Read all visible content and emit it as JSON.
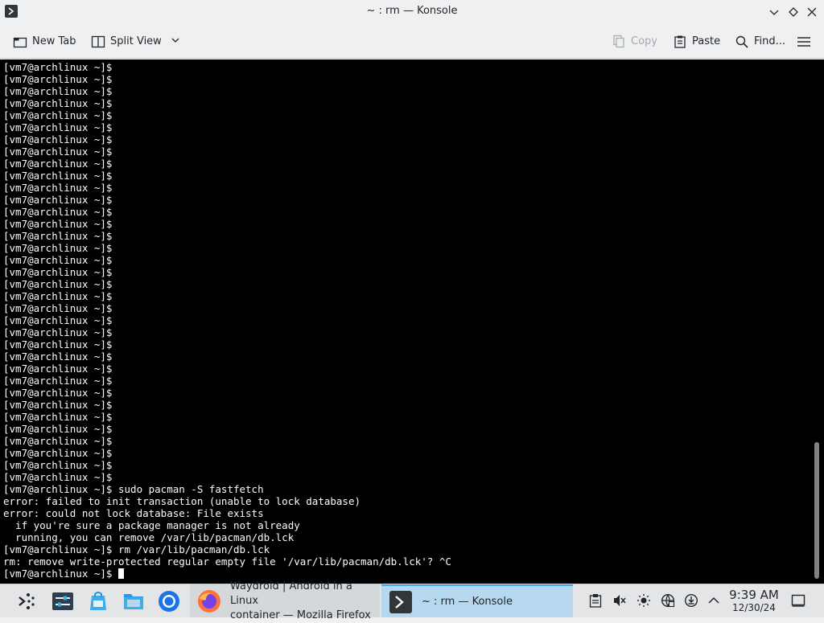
{
  "window": {
    "title": "~ : rm — Konsole"
  },
  "toolbar": {
    "new_tab": "New Tab",
    "split_view": "Split View",
    "copy": "Copy",
    "paste": "Paste",
    "find": "Find..."
  },
  "terminal": {
    "lines": [
      "[vm7@archlinux ~]$",
      "[vm7@archlinux ~]$",
      "[vm7@archlinux ~]$",
      "[vm7@archlinux ~]$",
      "[vm7@archlinux ~]$",
      "[vm7@archlinux ~]$",
      "[vm7@archlinux ~]$",
      "[vm7@archlinux ~]$",
      "[vm7@archlinux ~]$",
      "[vm7@archlinux ~]$",
      "[vm7@archlinux ~]$",
      "[vm7@archlinux ~]$",
      "[vm7@archlinux ~]$",
      "[vm7@archlinux ~]$",
      "[vm7@archlinux ~]$",
      "[vm7@archlinux ~]$",
      "[vm7@archlinux ~]$",
      "[vm7@archlinux ~]$",
      "[vm7@archlinux ~]$",
      "[vm7@archlinux ~]$",
      "[vm7@archlinux ~]$",
      "[vm7@archlinux ~]$",
      "[vm7@archlinux ~]$",
      "[vm7@archlinux ~]$",
      "[vm7@archlinux ~]$",
      "[vm7@archlinux ~]$",
      "[vm7@archlinux ~]$",
      "[vm7@archlinux ~]$",
      "[vm7@archlinux ~]$",
      "[vm7@archlinux ~]$",
      "[vm7@archlinux ~]$",
      "[vm7@archlinux ~]$",
      "[vm7@archlinux ~]$",
      "[vm7@archlinux ~]$",
      "[vm7@archlinux ~]$",
      "[vm7@archlinux ~]$",
      "[vm7@archlinux ~]$",
      "[vm7@archlinux ~]$",
      "[vm7@archlinux ~]$",
      "[vm7@archlinux ~]$",
      "[vm7@archlinux ~]$",
      "[vm7@archlinux ~]$",
      "[vm7@archlinux ~]$",
      "[vm7@archlinux ~]$",
      "[vm7@archlinux ~]$",
      "[vm7@archlinux ~]$",
      "[vm7@archlinux ~]$",
      "[vm7@archlinux ~]$",
      "[vm7@archlinux ~]$",
      "[vm7@archlinux ~]$",
      "[vm7@archlinux ~]$",
      "[vm7@archlinux ~]$",
      "[vm7@archlinux ~]$",
      "[vm7@archlinux ~]$",
      "[vm7@archlinux ~]$",
      "[vm7@archlinux ~]$",
      "[vm7@archlinux ~]$",
      "[vm7@archlinux ~]$",
      "[vm7@archlinux ~]$",
      "[vm7@archlinux ~]$",
      "[vm7@archlinux ~]$",
      "[vm7@archlinux ~]$",
      "[vm7@archlinux ~]$",
      "[vm7@archlinux ~]$",
      "[vm7@archlinux ~]$",
      "[vm7@archlinux ~]$",
      "[vm7@archlinux ~]$",
      "[vm7@archlinux ~]$",
      "[vm7@archlinux ~]$",
      "[vm7@archlinux ~]$",
      "[vm7@archlinux ~]$",
      "[vm7@archlinux ~]$",
      "[vm7@archlinux ~]$",
      "[vm7@archlinux ~]$",
      "[vm7@archlinux ~]$",
      "[vm7@archlinux ~]$",
      "[vm7@archlinux ~]$",
      "[vm7@archlinux ~]$",
      "[vm7@archlinux ~]$",
      "[vm7@archlinux ~]$",
      "[vm7@archlinux ~]$",
      "[vm7@archlinux ~]$",
      "[vm7@archlinux ~]$",
      "[vm7@archlinux ~]$ sudo pacman -S fastfetch",
      "error: failed to init transaction (unable to lock database)",
      "error: could not lock database: File exists",
      "  if you're sure a package manager is not already",
      "  running, you can remove /var/lib/pacman/db.lck",
      "[vm7@archlinux ~]$ rm /var/lib/pacman/db.lck",
      "rm: remove write-protected regular empty file '/var/lib/pacman/db.lck'? ^C"
    ],
    "prompt": "[vm7@archlinux ~]$ "
  },
  "taskbar": {
    "tasks": [
      {
        "label": "Waydroid | Android in a Linux container — Mozilla Firefox",
        "line1": "Waydroid | Android in a Linux",
        "line2": "container — Mozilla Firefox",
        "icon": "firefox-icon"
      },
      {
        "label": "~ : rm — Konsole",
        "icon": "konsole-icon"
      }
    ],
    "clock": {
      "time": "9:39 AM",
      "date": "12/30/24"
    }
  },
  "colors": {
    "terminal_bg": "#000000",
    "terminal_fg": "#fcfcfc",
    "accent": "#3daee9"
  }
}
